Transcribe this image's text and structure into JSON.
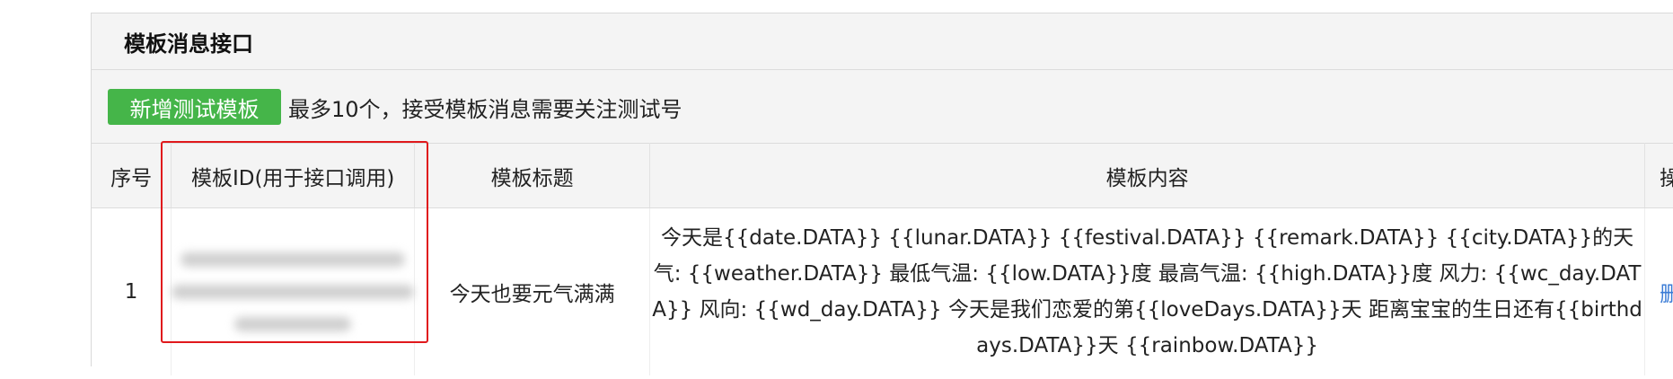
{
  "panel": {
    "title": "模板消息接口"
  },
  "toolbar": {
    "add_label": "新增测试模板",
    "hint": "最多10个，接受模板消息需要关注测试号"
  },
  "table": {
    "headers": {
      "index": "序号",
      "template_id": "模板ID(用于接口调用)",
      "title": "模板标题",
      "content": "模板内容",
      "action": "操"
    },
    "rows": [
      {
        "index": "1",
        "title": "今天也要元气满满",
        "content": "今天是{{date.DATA}} {{lunar.DATA}} {{festival.DATA}} {{remark.DATA}} {{city.DATA}}的天气: {{weather.DATA}} 最低气温: {{low.DATA}}度 最高气温: {{high.DATA}}度 风力: {{wc_day.DATA}} 风向: {{wd_day.DATA}} 今天是我们恋爱的第{{loveDays.DATA}}天 距离宝宝的生日还有{{birthdays.DATA}}天 {{rainbow.DATA}}",
        "action": "删"
      }
    ]
  },
  "colors": {
    "add_button": "#45b549",
    "highlight_border": "#e0191c",
    "link": "#3a7bd5"
  }
}
